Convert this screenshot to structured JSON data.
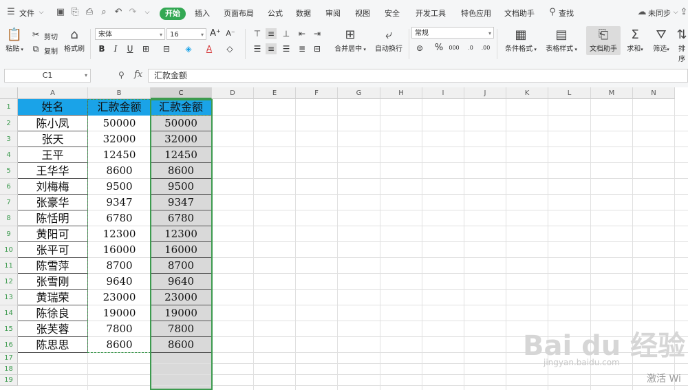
{
  "menu": {
    "file": "文件",
    "tabs": [
      "开始",
      "插入",
      "页面布局",
      "公式",
      "数据",
      "审阅",
      "视图",
      "安全",
      "开发工具",
      "特色应用",
      "文档助手"
    ],
    "active_tab": "开始",
    "search": "查找",
    "sync": "未同步"
  },
  "ribbon": {
    "paste": "粘贴",
    "cut": "剪切",
    "copy": "复制",
    "format_painter": "格式刷",
    "font_name": "宋体",
    "font_size": "16",
    "merge_center": "合并居中",
    "wrap_text": "自动换行",
    "number_format": "常规",
    "conditional_format": "条件格式",
    "table_style": "表格样式",
    "doc_assistant": "文档助手",
    "sum": "求和",
    "filter": "筛选",
    "sort": "排序"
  },
  "formula_bar": {
    "name_box": "C1",
    "fx_label": "fx",
    "content": "汇款金额"
  },
  "sheet": {
    "columns": [
      "A",
      "B",
      "C",
      "D",
      "E",
      "F",
      "G",
      "H",
      "I",
      "J",
      "K",
      "L",
      "M",
      "N"
    ],
    "rows": [
      "1",
      "2",
      "3",
      "4",
      "5",
      "6",
      "7",
      "8",
      "9",
      "10",
      "11",
      "12",
      "13",
      "14",
      "15",
      "16",
      "17",
      "18",
      "19"
    ],
    "header": {
      "a": "姓名",
      "b": "汇款金额",
      "c": "汇款金额"
    },
    "records": [
      {
        "name": "陈小凤",
        "b": "50000",
        "c": "50000"
      },
      {
        "name": "张天",
        "b": "32000",
        "c": "32000"
      },
      {
        "name": "王平",
        "b": "12450",
        "c": "12450"
      },
      {
        "name": "王华华",
        "b": "8600",
        "c": "8600"
      },
      {
        "name": "刘梅梅",
        "b": "9500",
        "c": "9500"
      },
      {
        "name": "张豪华",
        "b": "9347",
        "c": "9347"
      },
      {
        "name": "陈恬明",
        "b": "6780",
        "c": "6780"
      },
      {
        "name": "黄阳可",
        "b": "12300",
        "c": "12300"
      },
      {
        "name": "张平可",
        "b": "16000",
        "c": "16000"
      },
      {
        "name": "陈雪萍",
        "b": "8700",
        "c": "8700"
      },
      {
        "name": "张雪刚",
        "b": "9640",
        "c": "9640"
      },
      {
        "name": "黄瑞荣",
        "b": "23000",
        "c": "23000"
      },
      {
        "name": "陈徐良",
        "b": "19000",
        "c": "19000"
      },
      {
        "name": "张芙蓉",
        "b": "7800",
        "c": "7800"
      },
      {
        "name": "陈思思",
        "b": "8600",
        "c": "8600"
      }
    ]
  },
  "colors": {
    "header_fill": "#1aa3e8",
    "accent_green": "#33a853",
    "selection_gray": "#d9d9d9"
  },
  "watermark": {
    "logo": "Bai du 经验",
    "url": "jingyan.baidu.com",
    "activate": "激活 Wi"
  }
}
